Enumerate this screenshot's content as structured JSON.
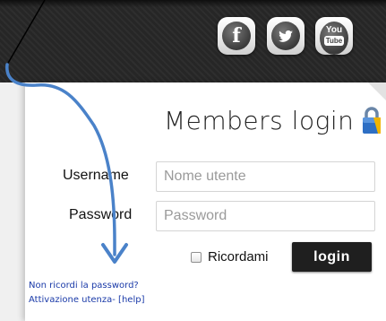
{
  "header": {
    "social": [
      {
        "name": "facebook",
        "glyph": "f"
      },
      {
        "name": "twitter",
        "glyph": ""
      },
      {
        "name": "youtube",
        "glyph_top": "You",
        "glyph_bottom": "Tube"
      }
    ]
  },
  "login": {
    "title": "Members login",
    "username_label": "Username",
    "username_placeholder": "Nome utente",
    "username_value": "",
    "password_label": "Password",
    "password_placeholder": "Password",
    "password_value": "",
    "remember_label": "Ricordami",
    "remember_checked": false,
    "submit_label": "login"
  },
  "links": {
    "forgot_password": "Non ricordi la password?",
    "activation": "Attivazione utenza- [help]"
  },
  "colors": {
    "header_bg": "#262626",
    "button_bg": "#1f1f1f",
    "link": "#1a3aa8",
    "annotation_arrow": "#4a82c9",
    "lock_icon": "#2e6fc4"
  },
  "icons": [
    "facebook-icon",
    "twitter-icon",
    "youtube-icon",
    "lock-icon",
    "annotation-arrow"
  ]
}
